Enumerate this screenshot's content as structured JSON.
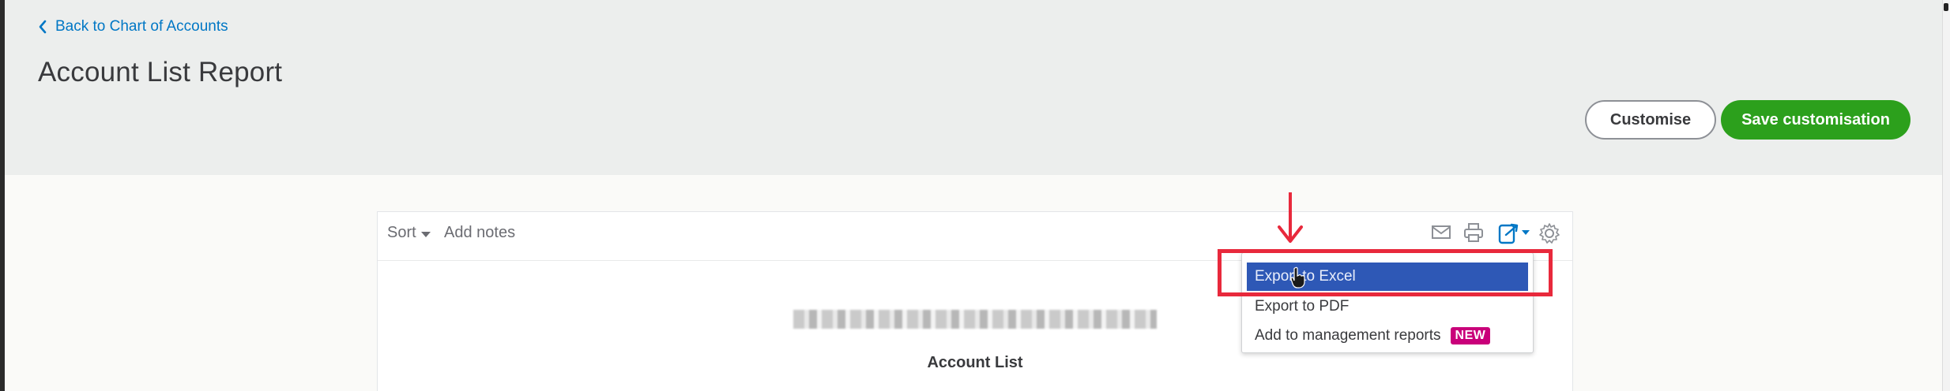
{
  "header": {
    "back_label": "Back to Chart of Accounts",
    "title": "Account List Report",
    "customise_label": "Customise",
    "save_label": "Save customisation",
    "save_color": "#2ca01c"
  },
  "toolbar": {
    "sort_label": "Sort",
    "notes_label": "Add notes",
    "icons": [
      "mail-icon",
      "print-icon",
      "export-icon",
      "gear-icon"
    ]
  },
  "report": {
    "name": "Account List"
  },
  "export_menu": {
    "items": [
      {
        "label": "Export to Excel",
        "highlighted": true
      },
      {
        "label": "Export to PDF"
      },
      {
        "label": "Add to management reports",
        "badge": "NEW"
      }
    ],
    "highlight_color": "#2e58b6",
    "badge_color": "#c9007a"
  },
  "annotation": {
    "color": "#e8293c"
  }
}
